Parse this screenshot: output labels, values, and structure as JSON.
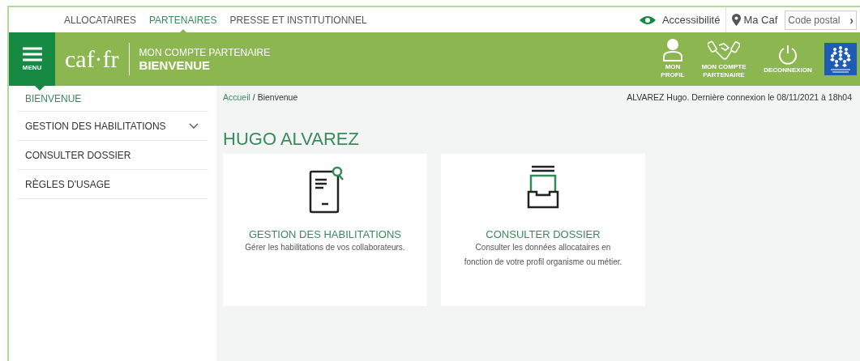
{
  "top_nav": {
    "items": [
      {
        "label": "ALLOCATAIRES",
        "selected": false
      },
      {
        "label": "PARTENAIRES",
        "selected": true
      },
      {
        "label": "PRESSE ET INSTITUTIONNEL",
        "selected": false
      }
    ],
    "accessibility": "Accessibilité",
    "my_caf": "Ma Caf",
    "postal_code": {
      "placeholder": "Code postal",
      "arrow": "›"
    }
  },
  "header": {
    "menu_label": "MENU",
    "logo": "caf·fr",
    "subtitle": "MON COMPTE PARTENAIRE",
    "title": "BIENVENUE",
    "actions": [
      {
        "kind": "profile",
        "label": "MON PROFIL"
      },
      {
        "kind": "partner",
        "label": "MON COMPTE PARTENAIRE"
      },
      {
        "kind": "logout",
        "label": "DECONNEXION"
      }
    ]
  },
  "sidebar": {
    "items": [
      {
        "label": "BIENVENUE",
        "selected": true
      },
      {
        "label": "GESTION DES HABILITATIONS",
        "selected": false,
        "expanded": false
      },
      {
        "label": "CONSULTER DOSSIER",
        "selected": false
      },
      {
        "label": "RÈGLES D'USAGE",
        "selected": false
      }
    ]
  },
  "breadcrumb": {
    "link": "Accueil",
    "separator": "/",
    "current": "Bienvenue"
  },
  "last_login": "ALVAREZ Hugo. Dernière connexion le 08/11/2021 à 18h04",
  "heading": "HUGO ALVAREZ",
  "cards": [
    {
      "kind": "certificate",
      "title": "GESTION DES HABILITATIONS",
      "description": "Gérer les habilitations de vos collaborateurs."
    },
    {
      "kind": "archive",
      "title": "CONSULTER DOSSIER",
      "description": "Consulter les données allocataires en fonction de votre profil organisme ou métier."
    }
  ]
}
